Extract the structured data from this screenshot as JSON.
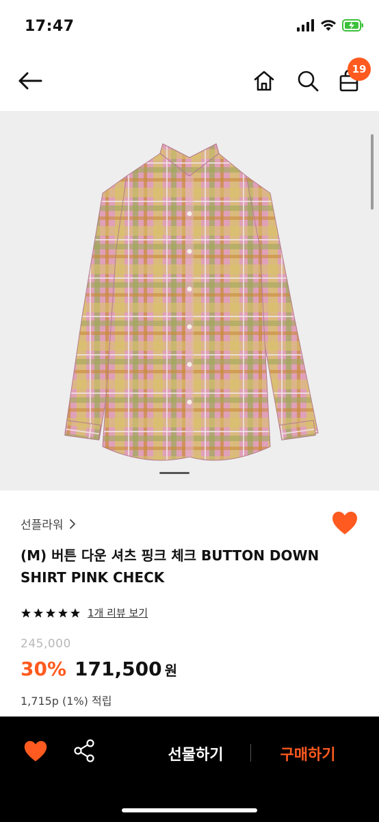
{
  "status_bar": {
    "time": "17:47",
    "icons": [
      "signal-icon",
      "wifi-icon",
      "battery-charging-icon"
    ]
  },
  "nav": {
    "back_icon": "arrow-left-icon",
    "home_icon": "home-icon",
    "search_icon": "search-icon",
    "cart_icon": "shopping-bag-icon",
    "cart_count": "19"
  },
  "product": {
    "image_subject": "pink plaid button-down shirt",
    "brand": "선플라워",
    "title": "(M) 버튼 다운 셔츠 핑크 체크 BUTTON DOWN SHIRT PINK CHECK",
    "rating_stars": 5,
    "review_link": "1개 리뷰 보기",
    "original_price": "245,000",
    "discount": "30%",
    "sale_price": "171,500",
    "currency": "원",
    "points": "1,715p (1%) 적립",
    "liked": true
  },
  "bottom_bar": {
    "heart_icon": "heart-icon",
    "share_icon": "share-icon",
    "gift_label": "선물하기",
    "buy_label": "구매하기"
  },
  "colors": {
    "accent": "#ff5a1f",
    "bottom_bar_bg": "#000000",
    "image_bg": "#eeeeee"
  }
}
